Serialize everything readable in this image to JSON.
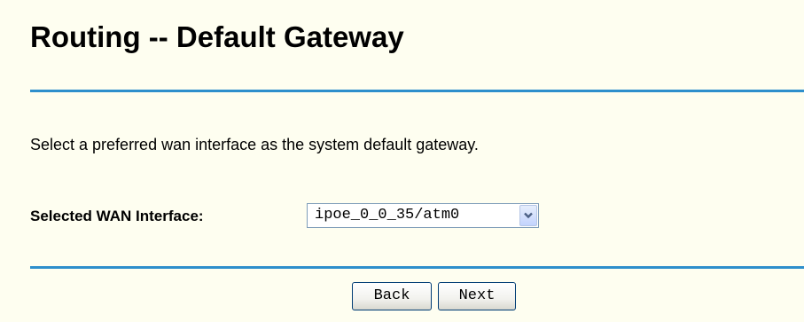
{
  "page": {
    "title": "Routing -- Default Gateway",
    "description": "Select a preferred wan interface as the system default gateway."
  },
  "form": {
    "wan_interface_label": "Selected WAN Interface:",
    "wan_interface_value": "ipoe_0_0_35/atm0"
  },
  "buttons": {
    "back_label": "Back",
    "next_label": "Next"
  },
  "colors": {
    "background": "#fefef0",
    "divider": "#2e8fcc",
    "select_arrow": "#4d6185"
  },
  "icons": {
    "dropdown": "chevron-down-icon"
  }
}
